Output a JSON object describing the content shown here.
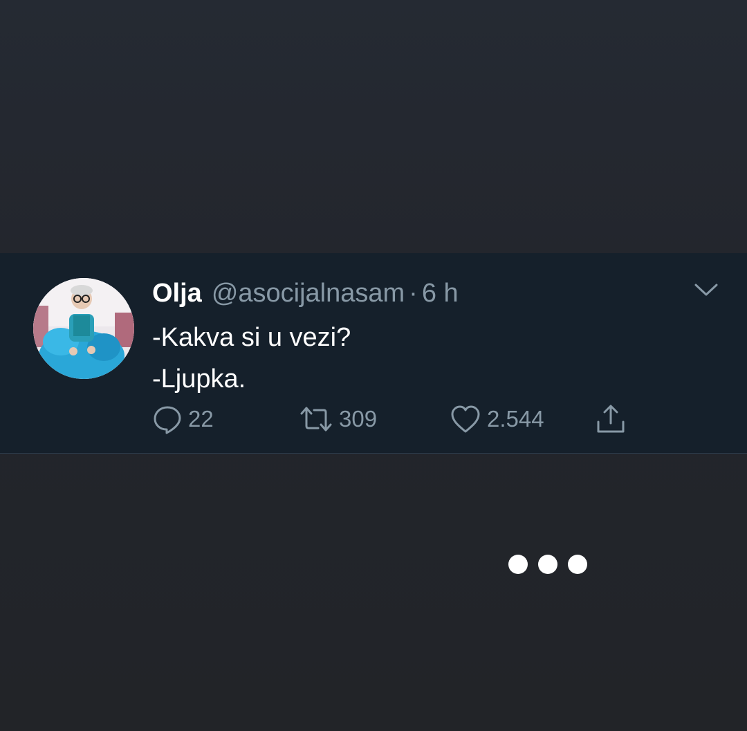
{
  "tweet": {
    "display_name": "Olja",
    "handle": "@asocijalnasam",
    "separator": "·",
    "timestamp": "6 h",
    "text_lines": [
      "-Kakva si u vezi?",
      "-Ljupka."
    ],
    "avatar_icon": "profile-photo",
    "menu_icon": "chevron-down-icon"
  },
  "actions": {
    "reply": {
      "icon": "reply-icon",
      "count": "22"
    },
    "retweet": {
      "icon": "retweet-icon",
      "count": "309"
    },
    "like": {
      "icon": "heart-icon",
      "count": "2.544"
    },
    "share": {
      "icon": "share-icon"
    }
  },
  "typing_indicator": {
    "dots": 3
  },
  "colors": {
    "background": "#23262d",
    "card": "#15202b",
    "primary_text": "#ffffff",
    "secondary_text": "#8899a6"
  }
}
